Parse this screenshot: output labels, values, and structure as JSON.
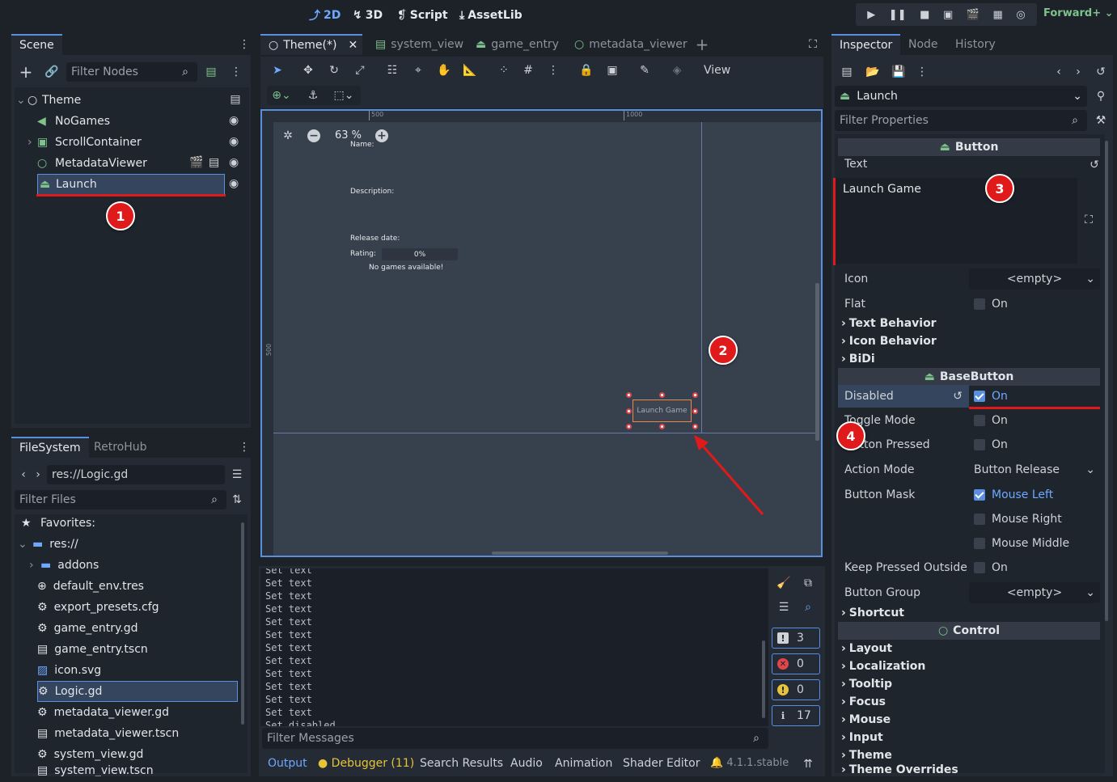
{
  "topbar": {
    "modes": [
      "2D",
      "3D",
      "Script",
      "AssetLib"
    ],
    "renderer": "Forward+"
  },
  "scene_dock": {
    "tab": "Scene",
    "filter_placeholder": "Filter Nodes",
    "nodes": [
      {
        "name": "Theme"
      },
      {
        "name": "NoGames"
      },
      {
        "name": "ScrollContainer"
      },
      {
        "name": "MetadataViewer"
      },
      {
        "name": "Launch"
      }
    ]
  },
  "filesystem_dock": {
    "tabs": [
      "FileSystem",
      "RetroHub"
    ],
    "path": "res://Logic.gd",
    "filter_placeholder": "Filter Files",
    "items": [
      "Favorites:",
      "res://",
      "addons",
      "default_env.tres",
      "export_presets.cfg",
      "game_entry.gd",
      "game_entry.tscn",
      "icon.svg",
      "Logic.gd",
      "metadata_viewer.gd",
      "metadata_viewer.tscn",
      "system_view.gd",
      "system_view.tscn"
    ]
  },
  "editor_tabs": [
    "Theme(*)",
    "system_view",
    "game_entry",
    "metadata_viewer"
  ],
  "toolbar": {
    "view_label": "View"
  },
  "viewport": {
    "zoom": "63 %",
    "ruler_500": "500",
    "ruler_1000": "1000",
    "ruler_v500": "500",
    "labels": {
      "name": "Name:",
      "description": "Description:",
      "release": "Release date:",
      "rating": "Rating:",
      "rating_value": "0%",
      "no_games": "No games available!",
      "launch": "Launch Game"
    }
  },
  "console": {
    "lines": [
      "Set text",
      "Set text",
      "Set text",
      "Set text",
      "Set text",
      "Set text",
      "Set text",
      "Set text",
      "Set text",
      "Set text",
      "Set text",
      "Set text",
      "Set disabled"
    ],
    "filter_placeholder": "Filter Messages",
    "counts": {
      "messages": "3",
      "errors": "0",
      "warnings": "0",
      "info": "17"
    }
  },
  "bottom_tabs": [
    "Output",
    "Debugger (11)",
    "Search Results",
    "Audio",
    "Animation",
    "Shader Editor"
  ],
  "version": "4.1.1.stable",
  "inspector": {
    "tabs": [
      "Inspector",
      "Node",
      "History"
    ],
    "node_name": "Launch",
    "filter_placeholder": "Filter Properties",
    "button_section": "Button",
    "text_label": "Text",
    "text_value": "Launch Game",
    "icon_label": "Icon",
    "icon_value": "<empty>",
    "flat_label": "Flat",
    "on": "On",
    "groups_button": [
      "Text Behavior",
      "Icon Behavior",
      "BiDi"
    ],
    "basebutton_section": "BaseButton",
    "disabled_label": "Disabled",
    "toggle_label": "Toggle Mode",
    "button_pressed_label": "Button Pressed",
    "action_mode_label": "Action Mode",
    "action_mode_value": "Button Release",
    "button_mask_label": "Button Mask",
    "mask_left": "Mouse Left",
    "mask_right": "Mouse Right",
    "mask_middle": "Mouse Middle",
    "keep_pressed_label": "Keep Pressed Outside",
    "button_group_label": "Button Group",
    "button_group_value": "<empty>",
    "shortcut": "Shortcut",
    "control_section": "Control",
    "control_groups": [
      "Layout",
      "Localization",
      "Tooltip",
      "Focus",
      "Mouse",
      "Input",
      "Theme",
      "Theme Overrides"
    ]
  },
  "annotations": [
    "1",
    "2",
    "3",
    "4"
  ],
  "colors": {
    "accent": "#5a8fe0",
    "annotation": "#e01a1a",
    "node_green": "#7ec28c"
  }
}
